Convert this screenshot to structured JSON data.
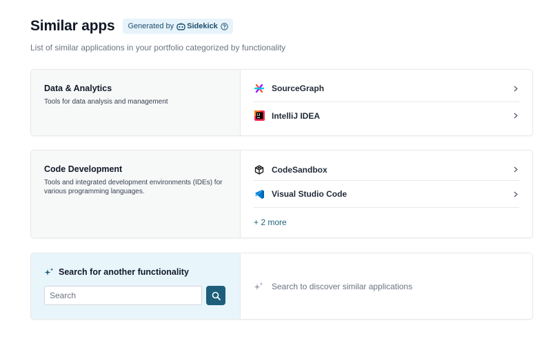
{
  "header": {
    "title": "Similar apps",
    "badge_prefix": "Generated by",
    "badge_brand": "Sidekick",
    "subtitle": "List of similar applications in your portfolio categorized by functionality"
  },
  "categories": [
    {
      "title": "Data & Analytics",
      "description": "Tools for data analysis and management",
      "apps": [
        {
          "name": "SourceGraph",
          "icon": "sourcegraph-icon"
        },
        {
          "name": "IntelliJ IDEA",
          "icon": "intellij-icon"
        }
      ]
    },
    {
      "title": "Code Development",
      "description": "Tools and integrated development environments (IDEs) for various programming languages.",
      "apps": [
        {
          "name": "CodeSandbox",
          "icon": "codesandbox-icon"
        },
        {
          "name": "Visual Studio Code",
          "icon": "vscode-icon"
        }
      ],
      "more": "+ 2 more"
    }
  ],
  "search": {
    "title": "Search for another functionality",
    "placeholder": "Search",
    "discover_text": "Search to discover similar applications"
  },
  "colors": {
    "accent": "#1d5f7a",
    "badge_bg": "#e6f3fb",
    "search_panel_bg": "#e8f5fb"
  }
}
